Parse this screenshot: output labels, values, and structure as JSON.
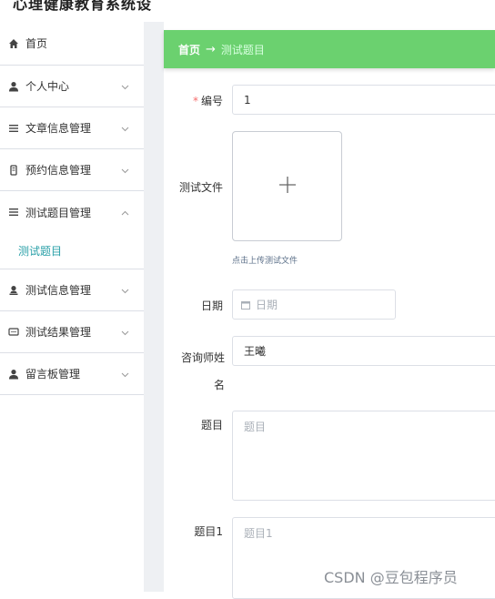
{
  "app": {
    "title": "心理健康教育系统设"
  },
  "sidebar": {
    "items": [
      {
        "label": "首页",
        "icon": "home-icon"
      },
      {
        "label": "个人中心",
        "icon": "person-icon"
      },
      {
        "label": "文章信息管理",
        "icon": "list-icon"
      },
      {
        "label": "预约信息管理",
        "icon": "document-icon"
      },
      {
        "label": "测试题目管理",
        "icon": "list-icon",
        "expanded": true,
        "submenu": [
          "测试题目"
        ]
      },
      {
        "label": "测试信息管理",
        "icon": "person-icon"
      },
      {
        "label": "测试结果管理",
        "icon": "message-icon"
      },
      {
        "label": "留言板管理",
        "icon": "person-icon"
      }
    ]
  },
  "breadcrumb": {
    "home": "首页",
    "arrow": "→",
    "current": "测试题目"
  },
  "form": {
    "id": {
      "label": "编号",
      "required_mark": "*",
      "value": "1"
    },
    "file": {
      "label": "测试文件",
      "plus": "+",
      "hint": "点击上传测试文件"
    },
    "date": {
      "label": "日期",
      "placeholder": "日期"
    },
    "counselor": {
      "label_line1": "咨询师姓",
      "label_line2": "名",
      "value": "王曦"
    },
    "question": {
      "label": "题目",
      "placeholder": "题目"
    },
    "question1": {
      "label": "题目1",
      "placeholder": "题目1"
    }
  },
  "watermark": "CSDN @豆包程序员",
  "colors": {
    "banner": "#6bd16f",
    "accent": "#2aa0a8",
    "required": "#f56c6c"
  }
}
